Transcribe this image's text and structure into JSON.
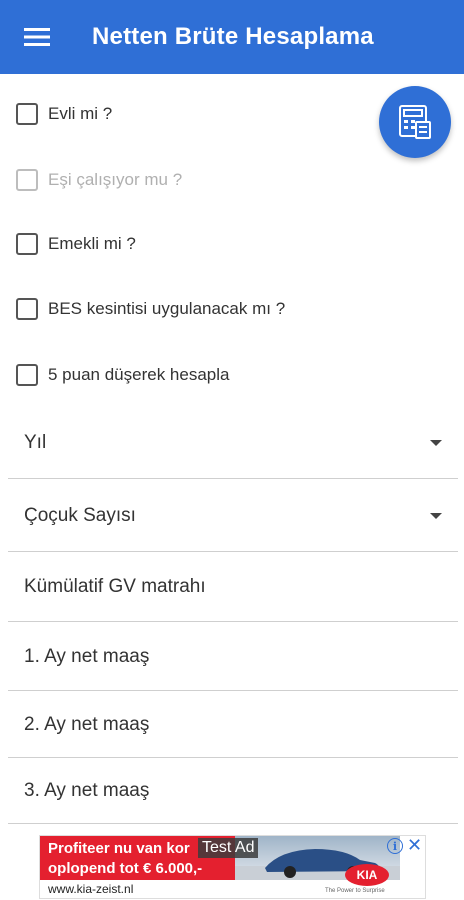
{
  "appbar": {
    "title": "Netten Brüte Hesaplama",
    "menu_icon": "menu-icon",
    "bg_color": "#2f6fd6"
  },
  "fab": {
    "icon": "calculator-icon"
  },
  "checkboxes": [
    {
      "label": "Evli mi ?",
      "checked": false,
      "enabled": true
    },
    {
      "label": "Eşi çalışıyor mu ?",
      "checked": false,
      "enabled": false
    },
    {
      "label": "Emekli mi ?",
      "checked": false,
      "enabled": true
    },
    {
      "label": "BES kesintisi uygulanacak mı ?",
      "checked": false,
      "enabled": true
    },
    {
      "label": "5 puan düşerek hesapla",
      "checked": false,
      "enabled": true
    }
  ],
  "dropdowns": [
    {
      "placeholder": "Yıl"
    },
    {
      "placeholder": "Çoçuk Sayısı"
    }
  ],
  "inputs": [
    {
      "placeholder": "Kümülatif GV matrahı"
    },
    {
      "placeholder": "1. Ay net maaş"
    },
    {
      "placeholder": "2. Ay net maaş"
    },
    {
      "placeholder": "3. Ay net maaş"
    }
  ],
  "ad": {
    "test_label": "Test Ad",
    "line1": "Profiteer nu van kor",
    "line2": "oplopend tot € 6.000,-",
    "url": "www.kia-zeist.nl",
    "brand": "KIA",
    "tagline": "The Power to Surprise",
    "brand_color": "#e4202f"
  }
}
